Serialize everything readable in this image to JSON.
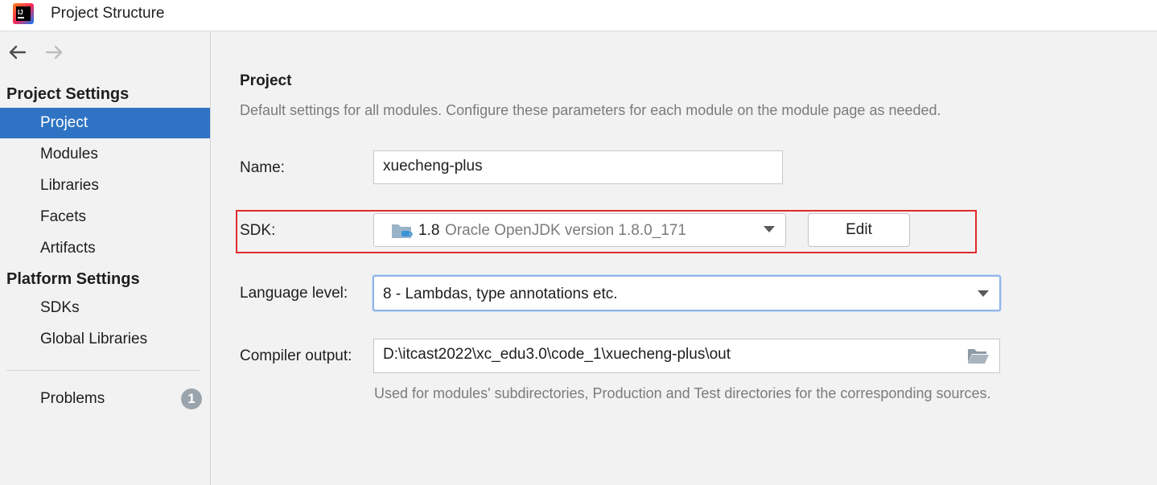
{
  "window": {
    "title": "Project Structure",
    "icon": "intellij-idea-logo"
  },
  "nav": {
    "back_icon": "arrow-left-icon",
    "forward_icon": "arrow-right-icon"
  },
  "sidebar": {
    "project_settings_header": "Project Settings",
    "project_settings_items": [
      {
        "label": "Project",
        "selected": true
      },
      {
        "label": "Modules"
      },
      {
        "label": "Libraries"
      },
      {
        "label": "Facets"
      },
      {
        "label": "Artifacts"
      }
    ],
    "platform_settings_header": "Platform Settings",
    "platform_settings_items": [
      {
        "label": "SDKs"
      },
      {
        "label": "Global Libraries"
      }
    ],
    "problems": {
      "label": "Problems",
      "count": "1"
    }
  },
  "main": {
    "title": "Project",
    "description": "Default settings for all modules. Configure these parameters for each module on the module page as needed.",
    "name": {
      "label": "Name:",
      "value": "xuecheng-plus"
    },
    "sdk": {
      "label": "SDK:",
      "version": "1.8",
      "detail": "Oracle OpenJDK version 1.8.0_171",
      "edit_button": "Edit",
      "icon": "jdk-folder-icon"
    },
    "language_level": {
      "label": "Language level:",
      "value": "8 - Lambdas, type annotations etc."
    },
    "compiler_output": {
      "label": "Compiler output:",
      "value": "D:\\itcast2022\\xc_edu3.0\\code_1\\xuecheng-plus\\out",
      "hint": "Used for modules' subdirectories, Production and Test directories for the corresponding sources.",
      "browse_icon": "folder-open-icon"
    }
  },
  "colors": {
    "selection": "#2f73c4",
    "annotation_red": "#e02a2a",
    "focus_blue": "#8fb3e6",
    "badge_gray": "#9aa4ad"
  }
}
